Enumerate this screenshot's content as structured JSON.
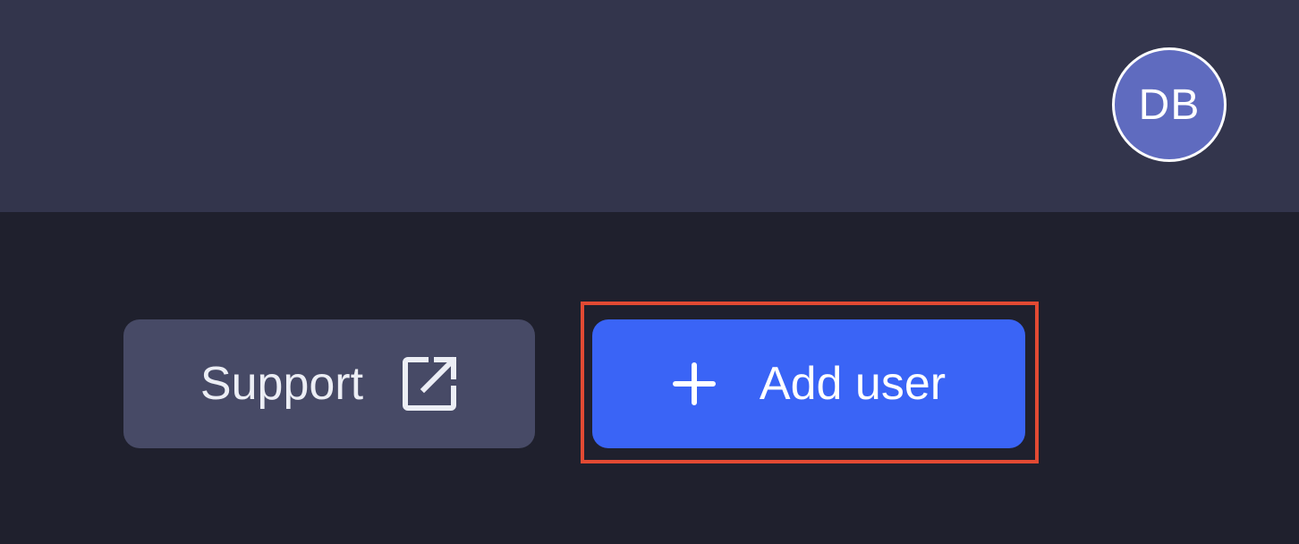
{
  "header": {
    "avatar_initials": "DB"
  },
  "actions": {
    "support_label": "Support",
    "add_user_label": "Add user"
  },
  "colors": {
    "header_bg": "#33354c",
    "content_bg": "#1f202d",
    "support_button_bg": "#474a66",
    "primary_button_bg": "#3a64f6",
    "avatar_bg": "#5f6bbf",
    "highlight_border": "#e24a33"
  },
  "icons": {
    "support": "external-link-icon",
    "add_user": "plus-icon"
  }
}
